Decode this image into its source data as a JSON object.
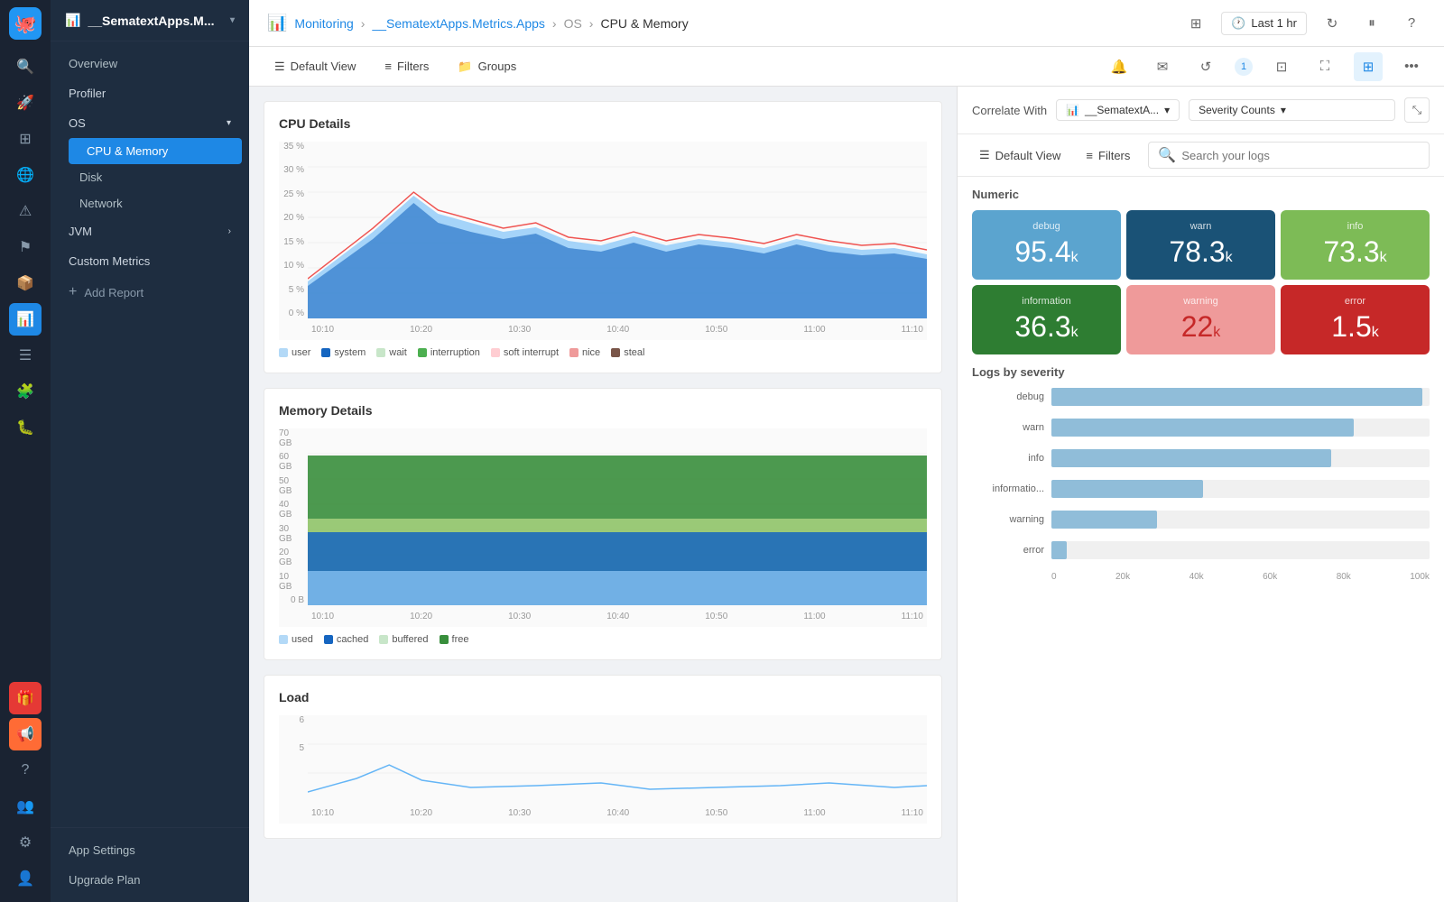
{
  "app": {
    "title": "__SematextApps.M...",
    "title_full": "__SematextApps.Metrics.Apps"
  },
  "breadcrumb": {
    "monitoring": "Monitoring",
    "app": "__SematextApps.Metrics.Apps",
    "os": "OS",
    "page": "CPU & Memory"
  },
  "topbar": {
    "time_label": "Last 1 hr",
    "refresh_label": "Refresh",
    "pause_label": "Pause",
    "help_label": "Help"
  },
  "toolbar": {
    "default_view": "Default View",
    "filters": "Filters",
    "groups": "Groups"
  },
  "nav": {
    "overview": "Overview",
    "profiler": "Profiler",
    "os": "OS",
    "cpu_memory": "CPU & Memory",
    "disk": "Disk",
    "network": "Network",
    "jvm": "JVM",
    "custom_metrics": "Custom Metrics",
    "add_report": "Add Report",
    "app_settings": "App Settings",
    "upgrade_plan": "Upgrade Plan"
  },
  "charts": {
    "cpu": {
      "title": "CPU Details",
      "y_labels": [
        "35 %",
        "30 %",
        "25 %",
        "20 %",
        "15 %",
        "10 %",
        "5 %",
        "0 %"
      ],
      "x_labels": [
        "10:10",
        "10:20",
        "10:30",
        "10:40",
        "10:50",
        "11:00",
        "11:10"
      ],
      "legend": [
        {
          "label": "user",
          "color": "#90caf9"
        },
        {
          "label": "system",
          "color": "#1565c0"
        },
        {
          "label": "wait",
          "color": "#c8e6c9"
        },
        {
          "label": "interruption",
          "color": "#4caf50"
        },
        {
          "label": "soft interrupt",
          "color": "#ffcdd2"
        },
        {
          "label": "nice",
          "color": "#ef9a9a"
        },
        {
          "label": "steal",
          "color": "#795548"
        }
      ]
    },
    "memory": {
      "title": "Memory Details",
      "y_labels": [
        "70 GB",
        "60 GB",
        "50 GB",
        "40 GB",
        "30 GB",
        "20 GB",
        "10 GB",
        "0 B"
      ],
      "x_labels": [
        "10:10",
        "10:20",
        "10:30",
        "10:40",
        "10:50",
        "11:00",
        "11:10"
      ],
      "legend": [
        {
          "label": "used",
          "color": "#b3d9f7"
        },
        {
          "label": "cached",
          "color": "#1565c0"
        },
        {
          "label": "buffered",
          "color": "#c8e6c9"
        },
        {
          "label": "free",
          "color": "#388e3c"
        }
      ]
    },
    "load": {
      "title": "Load",
      "y_labels": [
        "6",
        "5"
      ],
      "x_labels": [
        "10:10",
        "10:20",
        "10:30",
        "10:40",
        "10:50",
        "11:00",
        "11:10"
      ]
    }
  },
  "right_panel": {
    "correlate_label": "Correlate With",
    "app_name": "__SematextA...",
    "severity_counts": "Severity Counts",
    "default_view": "Default View",
    "filters": "Filters",
    "search_placeholder": "Search your logs",
    "numeric_title": "Numeric",
    "severity_cards": [
      {
        "label": "debug",
        "value": "95.4",
        "unit": "k",
        "class": "sev-debug"
      },
      {
        "label": "warn",
        "value": "78.3",
        "unit": "k",
        "class": "sev-warn"
      },
      {
        "label": "info",
        "value": "73.3",
        "unit": "k",
        "class": "sev-info"
      },
      {
        "label": "information",
        "value": "36.3",
        "unit": "k",
        "class": "sev-information"
      },
      {
        "label": "warning",
        "value": "22",
        "unit": "k",
        "class": "sev-warning"
      },
      {
        "label": "error",
        "value": "1.5",
        "unit": "k",
        "class": "sev-error"
      }
    ],
    "logs_by_severity": "Logs by severity",
    "bars": [
      {
        "label": "debug",
        "pct": 98
      },
      {
        "label": "warn",
        "pct": 80
      },
      {
        "label": "info",
        "pct": 74
      },
      {
        "label": "informatio...",
        "pct": 40
      },
      {
        "label": "warning",
        "pct": 28
      },
      {
        "label": "error",
        "pct": 4
      }
    ],
    "x_axis_labels": [
      "0",
      "20k",
      "40k",
      "60k",
      "80k",
      "100k"
    ]
  }
}
